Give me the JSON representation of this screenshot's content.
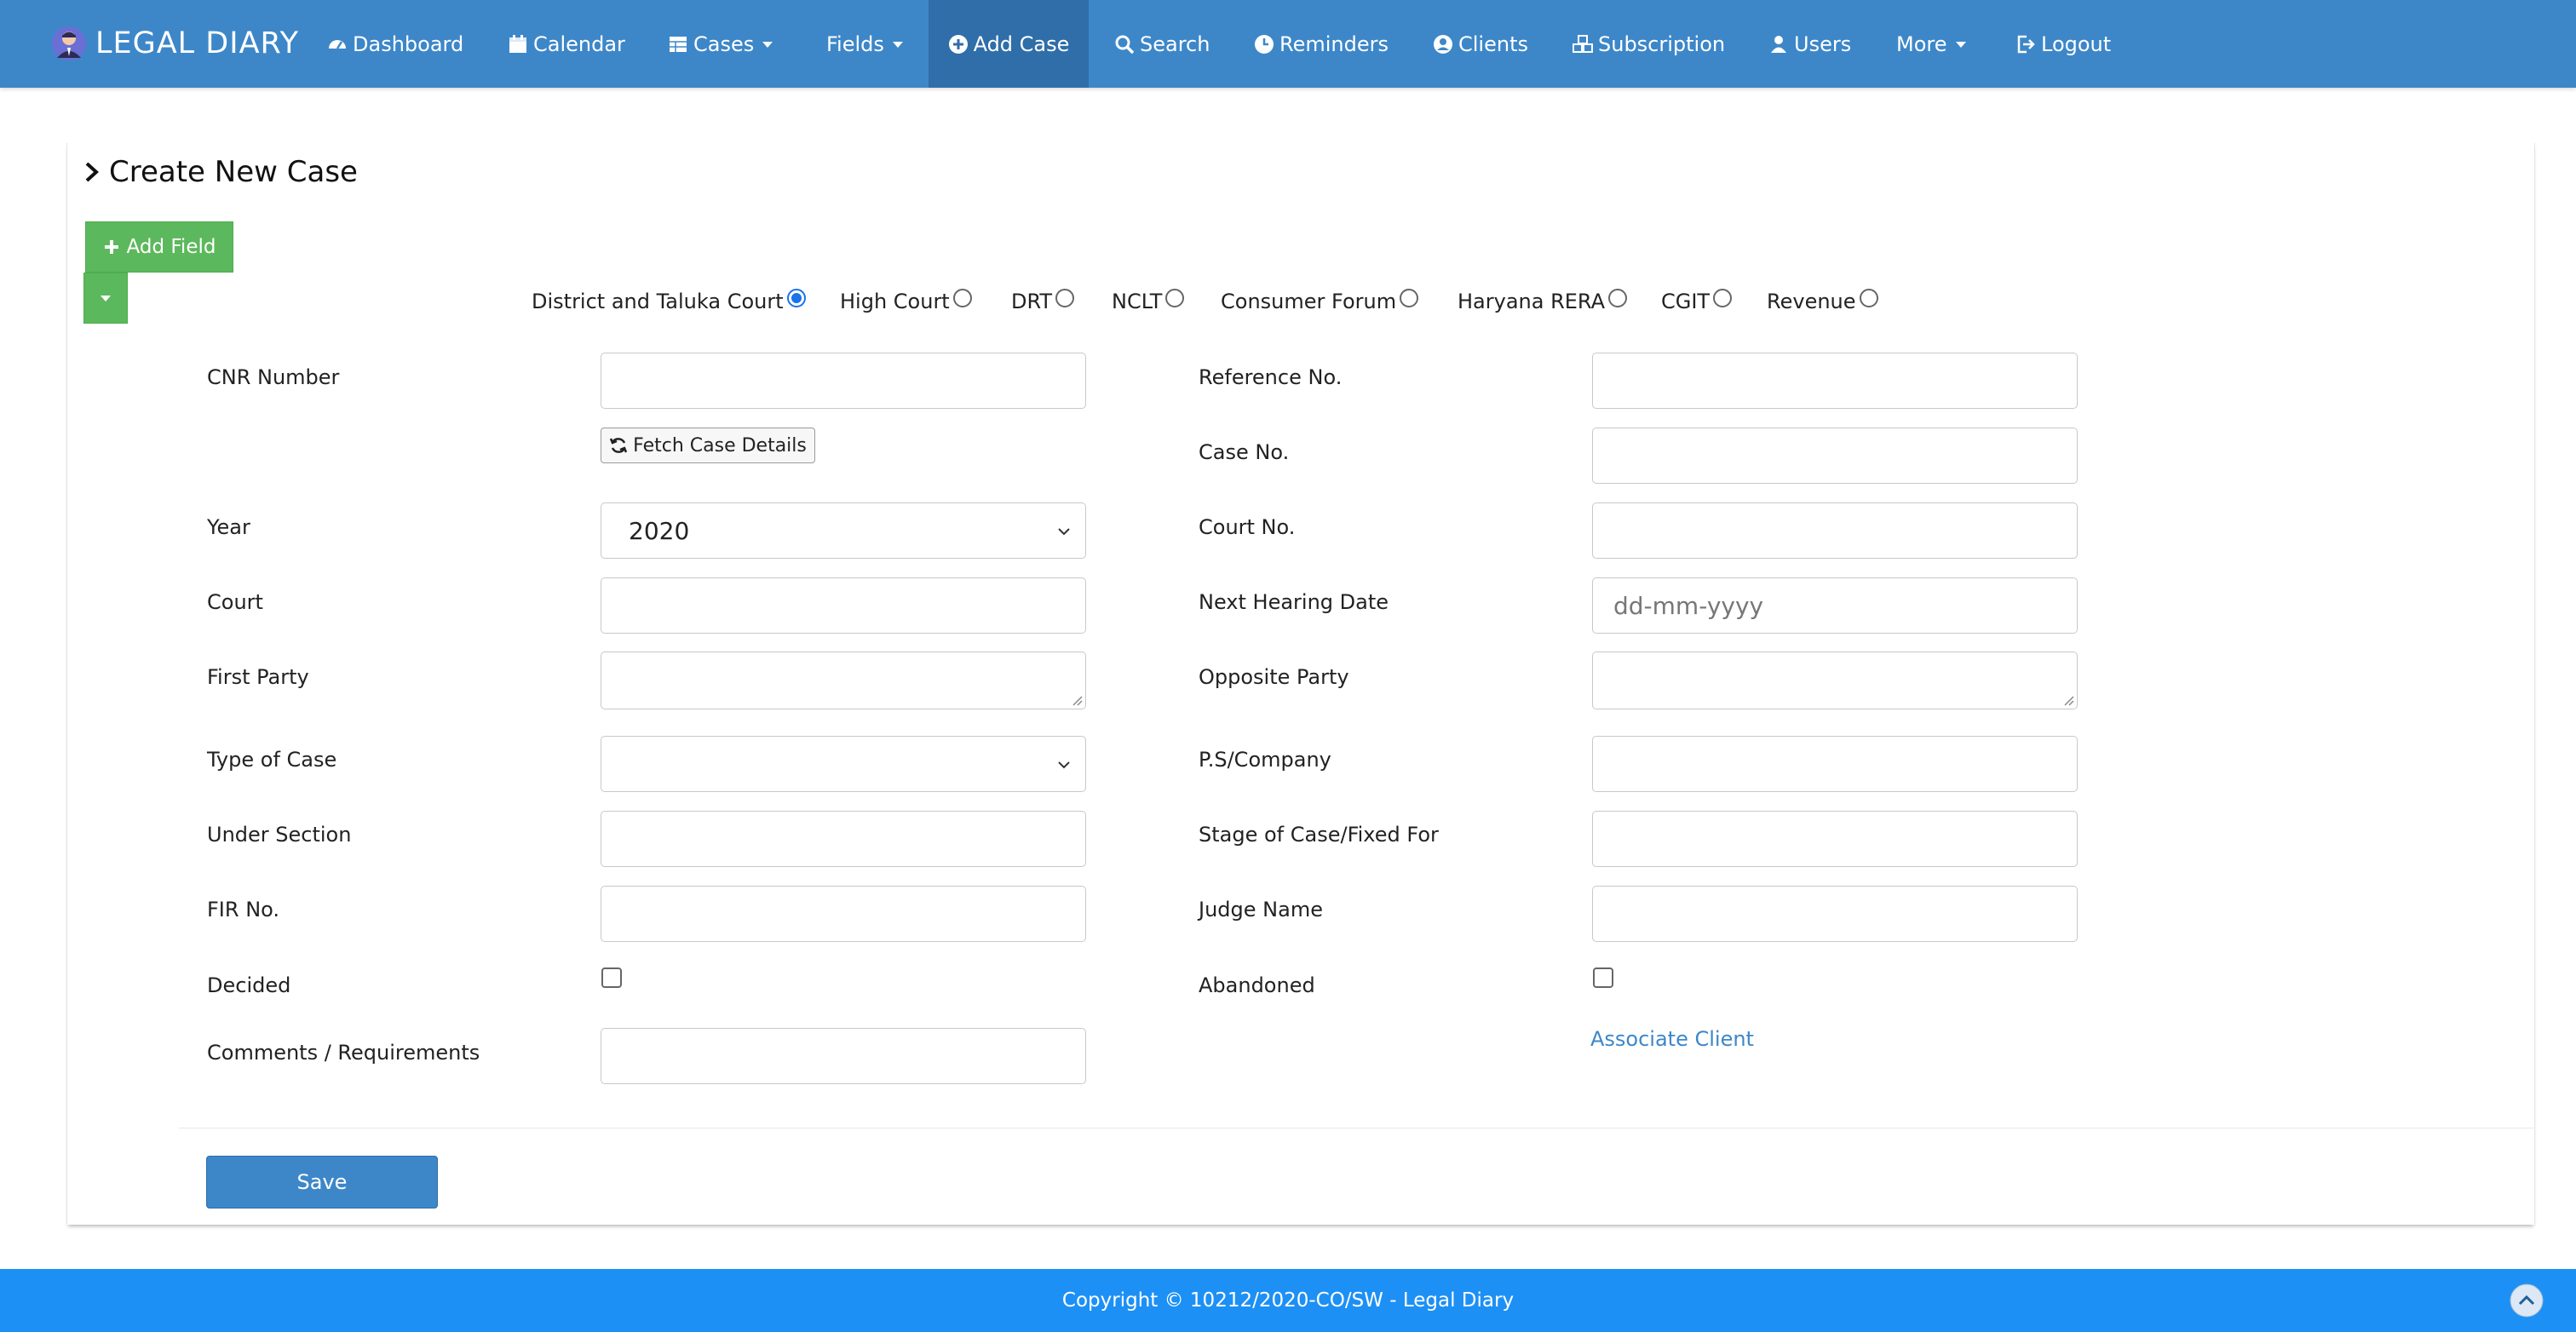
{
  "brand": {
    "name": "LEGAL DIARY"
  },
  "nav": {
    "dashboard": "Dashboard",
    "calendar": "Calendar",
    "cases": "Cases",
    "fields": "Fields",
    "add_case": "Add Case",
    "search": "Search",
    "reminders": "Reminders",
    "clients": "Clients",
    "subscription": "Subscription",
    "users": "Users",
    "more": "More",
    "logout": "Logout"
  },
  "page": {
    "title": "Create New Case",
    "add_field_label": "Add Field"
  },
  "court_types": [
    {
      "label": "District and Taluka Court",
      "checked": true
    },
    {
      "label": "High Court",
      "checked": false
    },
    {
      "label": "DRT",
      "checked": false
    },
    {
      "label": "NCLT",
      "checked": false
    },
    {
      "label": "Consumer Forum",
      "checked": false
    },
    {
      "label": "Haryana RERA",
      "checked": false
    },
    {
      "label": "CGIT",
      "checked": false
    },
    {
      "label": "Revenue",
      "checked": false
    }
  ],
  "form": {
    "left": {
      "cnr_number": {
        "label": "CNR Number",
        "value": ""
      },
      "fetch_label": "Fetch Case Details",
      "year": {
        "label": "Year",
        "value": "2020"
      },
      "court": {
        "label": "Court",
        "value": ""
      },
      "first_party": {
        "label": "First Party",
        "value": ""
      },
      "type_of_case": {
        "label": "Type of Case",
        "value": ""
      },
      "under_section": {
        "label": "Under Section",
        "value": ""
      },
      "fir_no": {
        "label": "FIR No.",
        "value": ""
      },
      "decided": {
        "label": "Decided",
        "checked": false
      },
      "comments": {
        "label": "Comments / Requirements",
        "value": ""
      }
    },
    "right": {
      "reference_no": {
        "label": "Reference No.",
        "value": ""
      },
      "case_no": {
        "label": "Case No.",
        "value": ""
      },
      "court_no": {
        "label": "Court No.",
        "value": ""
      },
      "next_hearing_date": {
        "label": "Next Hearing Date",
        "placeholder": "dd-mm-yyyy"
      },
      "opposite_party": {
        "label": "Opposite Party",
        "value": ""
      },
      "ps_company": {
        "label": "P.S/Company",
        "value": ""
      },
      "stage_of_case": {
        "label": "Stage of Case/Fixed For",
        "value": ""
      },
      "judge_name": {
        "label": "Judge Name",
        "value": ""
      },
      "abandoned": {
        "label": "Abandoned",
        "checked": false
      },
      "associate_client": "Associate Client"
    },
    "save_label": "Save"
  },
  "footer": {
    "copyright": "Copyright © 10212/2020-CO/SW - Legal Diary"
  },
  "colors": {
    "navbar": "#3d87c9",
    "navbar_active": "#2f6ea9",
    "green_button": "#5cb85c",
    "footer": "#1d90f5",
    "link": "#3d87c9"
  },
  "icons": {
    "brand": "lawyer-avatar-icon",
    "dashboard": "tachometer-icon",
    "calendar": "calendar-icon",
    "cases": "table-icon",
    "add_case": "plus-circle-icon",
    "search": "search-icon",
    "reminders": "clock-icon",
    "clients": "user-circle-icon",
    "subscription": "cubes-icon",
    "users": "user-icon",
    "logout": "sign-out-icon",
    "fetch": "refresh-icon",
    "scroll_top": "chevron-up-circle-icon"
  }
}
